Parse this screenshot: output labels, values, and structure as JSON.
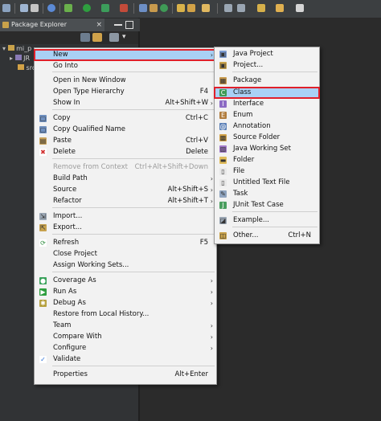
{
  "panel": {
    "title": "Package Explorer",
    "close_symbol": "×",
    "tree": [
      {
        "label": "mi_p",
        "icon": "project-folder-icon"
      },
      {
        "label": "JR",
        "icon": "library-icon"
      },
      {
        "label": "src",
        "icon": "source-folder-icon"
      }
    ]
  },
  "context_menu": {
    "items": [
      {
        "label": "New",
        "accel": "",
        "submenu": true,
        "icon": "none",
        "highlighted": true,
        "enabled": true
      },
      {
        "label": "Go Into",
        "accel": "",
        "submenu": false,
        "icon": "none",
        "enabled": true
      },
      {
        "label": "Open in New Window",
        "accel": "",
        "submenu": false,
        "icon": "none",
        "enabled": true
      },
      {
        "label": "Open Type Hierarchy",
        "accel": "F4",
        "submenu": false,
        "icon": "none",
        "enabled": true
      },
      {
        "label": "Show In",
        "accel": "Alt+Shift+W",
        "submenu": true,
        "icon": "none",
        "enabled": true
      },
      {
        "label": "Copy",
        "accel": "Ctrl+C",
        "submenu": false,
        "icon": "copy-icon",
        "enabled": true
      },
      {
        "label": "Copy Qualified Name",
        "accel": "",
        "submenu": false,
        "icon": "copy-qualified-icon",
        "enabled": true
      },
      {
        "label": "Paste",
        "accel": "Ctrl+V",
        "submenu": false,
        "icon": "paste-icon",
        "enabled": true
      },
      {
        "label": "Delete",
        "accel": "Delete",
        "submenu": false,
        "icon": "delete-icon",
        "enabled": true
      },
      {
        "label": "Remove from Context",
        "accel": "Ctrl+Alt+Shift+Down",
        "submenu": false,
        "icon": "none",
        "enabled": false
      },
      {
        "label": "Build Path",
        "accel": "",
        "submenu": true,
        "icon": "none",
        "enabled": true
      },
      {
        "label": "Source",
        "accel": "Alt+Shift+S",
        "submenu": true,
        "icon": "none",
        "enabled": true
      },
      {
        "label": "Refactor",
        "accel": "Alt+Shift+T",
        "submenu": true,
        "icon": "none",
        "enabled": true
      },
      {
        "label": "Import...",
        "accel": "",
        "submenu": false,
        "icon": "import-icon",
        "enabled": true
      },
      {
        "label": "Export...",
        "accel": "",
        "submenu": false,
        "icon": "export-icon",
        "enabled": true
      },
      {
        "label": "Refresh",
        "accel": "F5",
        "submenu": false,
        "icon": "refresh-icon",
        "enabled": true
      },
      {
        "label": "Close Project",
        "accel": "",
        "submenu": false,
        "icon": "none",
        "enabled": true
      },
      {
        "label": "Assign Working Sets...",
        "accel": "",
        "submenu": false,
        "icon": "none",
        "enabled": true
      },
      {
        "label": "Coverage As",
        "accel": "",
        "submenu": true,
        "icon": "coverage-icon",
        "enabled": true
      },
      {
        "label": "Run As",
        "accel": "",
        "submenu": true,
        "icon": "run-icon",
        "enabled": true
      },
      {
        "label": "Debug As",
        "accel": "",
        "submenu": true,
        "icon": "debug-icon",
        "enabled": true
      },
      {
        "label": "Restore from Local History...",
        "accel": "",
        "submenu": false,
        "icon": "none",
        "enabled": true
      },
      {
        "label": "Team",
        "accel": "",
        "submenu": true,
        "icon": "none",
        "enabled": true
      },
      {
        "label": "Compare With",
        "accel": "",
        "submenu": true,
        "icon": "none",
        "enabled": true
      },
      {
        "label": "Configure",
        "accel": "",
        "submenu": true,
        "icon": "none",
        "enabled": true
      },
      {
        "label": "Validate",
        "accel": "",
        "submenu": false,
        "icon": "validate-check-icon",
        "enabled": true
      },
      {
        "label": "Properties",
        "accel": "Alt+Enter",
        "submenu": false,
        "icon": "none",
        "enabled": true
      }
    ]
  },
  "new_submenu": {
    "items": [
      {
        "label": "Java Project",
        "accel": "",
        "icon": "java-project-icon"
      },
      {
        "label": "Project...",
        "accel": "",
        "icon": "project-icon"
      },
      {
        "label": "Package",
        "accel": "",
        "icon": "package-icon"
      },
      {
        "label": "Class",
        "accel": "",
        "icon": "class-icon",
        "highlighted": true
      },
      {
        "label": "Interface",
        "accel": "",
        "icon": "interface-icon"
      },
      {
        "label": "Enum",
        "accel": "",
        "icon": "enum-icon"
      },
      {
        "label": "Annotation",
        "accel": "",
        "icon": "annotation-icon"
      },
      {
        "label": "Source Folder",
        "accel": "",
        "icon": "source-folder-icon"
      },
      {
        "label": "Java Working Set",
        "accel": "",
        "icon": "working-set-icon"
      },
      {
        "label": "Folder",
        "accel": "",
        "icon": "folder-icon"
      },
      {
        "label": "File",
        "accel": "",
        "icon": "file-icon"
      },
      {
        "label": "Untitled Text File",
        "accel": "",
        "icon": "text-file-icon"
      },
      {
        "label": "Task",
        "accel": "",
        "icon": "task-icon"
      },
      {
        "label": "JUnit Test Case",
        "accel": "",
        "icon": "junit-icon"
      },
      {
        "label": "Example...",
        "accel": "",
        "icon": "example-icon"
      },
      {
        "label": "Other...",
        "accel": "Ctrl+N",
        "icon": "other-wizard-icon"
      }
    ]
  },
  "colors": {
    "highlight": "#a9d1f5",
    "highlight_border": "#e0202a",
    "menu_bg": "#f2f2f2",
    "ide_bg": "#2b2b2b"
  }
}
